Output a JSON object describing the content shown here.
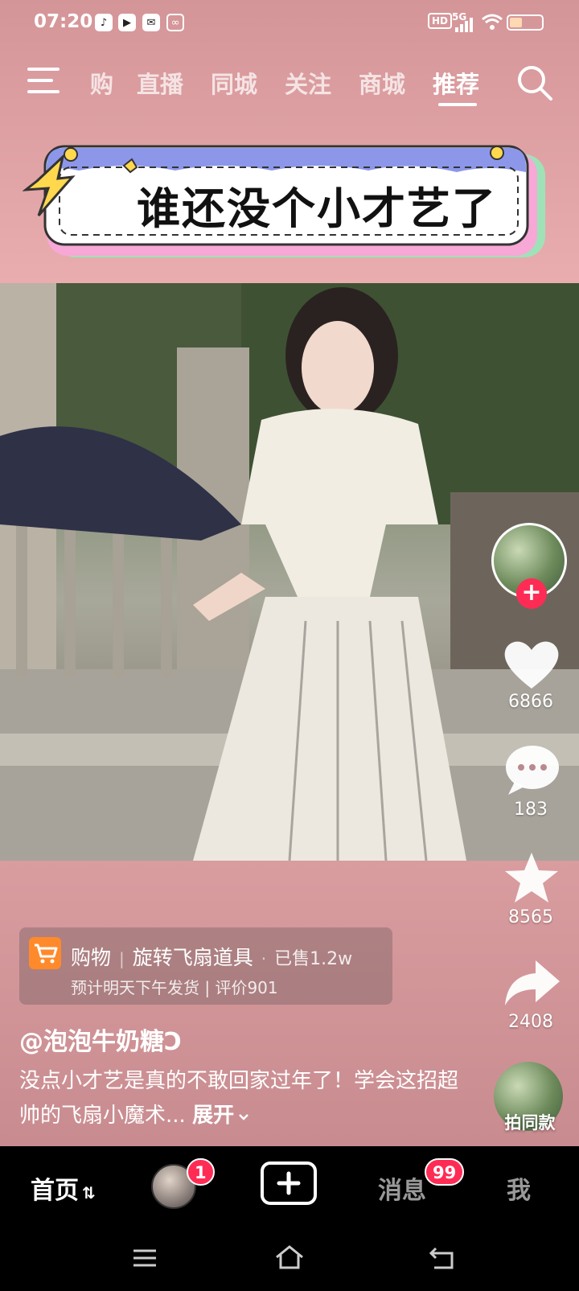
{
  "status_bar": {
    "time": "07:20",
    "app_icons": [
      "tiktok-icon",
      "video-play-icon",
      "mail-icon",
      "link-icon"
    ],
    "hd": "HD",
    "network": "5G",
    "battery_level": 0.4
  },
  "top_nav": {
    "tabs": [
      {
        "label": "购",
        "active": false
      },
      {
        "label": "直播",
        "active": false
      },
      {
        "label": "同城",
        "active": false
      },
      {
        "label": "关注",
        "active": false
      },
      {
        "label": "商城",
        "active": false
      },
      {
        "label": "推荐",
        "active": true
      }
    ]
  },
  "banner": {
    "text": "谁还没个小才艺了"
  },
  "rail": {
    "likes": "6866",
    "comments": "183",
    "favorites": "8565",
    "shares": "2408"
  },
  "product": {
    "category": "购物",
    "name": "旋转飞扇道具",
    "sold": "已售1.2w",
    "detail": "预计明天下午发货 | 评价901"
  },
  "post": {
    "author": "@泡泡牛奶糖Ↄ",
    "caption": "没点小才艺是真的不敢回家过年了！学会这招超帅的飞扇小魔术...",
    "expand": "展开"
  },
  "same_style": {
    "label": "拍同款"
  },
  "tabbar": {
    "home": "首页",
    "friend_badge": "1",
    "messages": "消息",
    "messages_badge": "99",
    "me": "我"
  },
  "colors": {
    "accent": "#fe2c55",
    "page_bg": "#e2a6a8",
    "cart": "#ff8a2b"
  }
}
